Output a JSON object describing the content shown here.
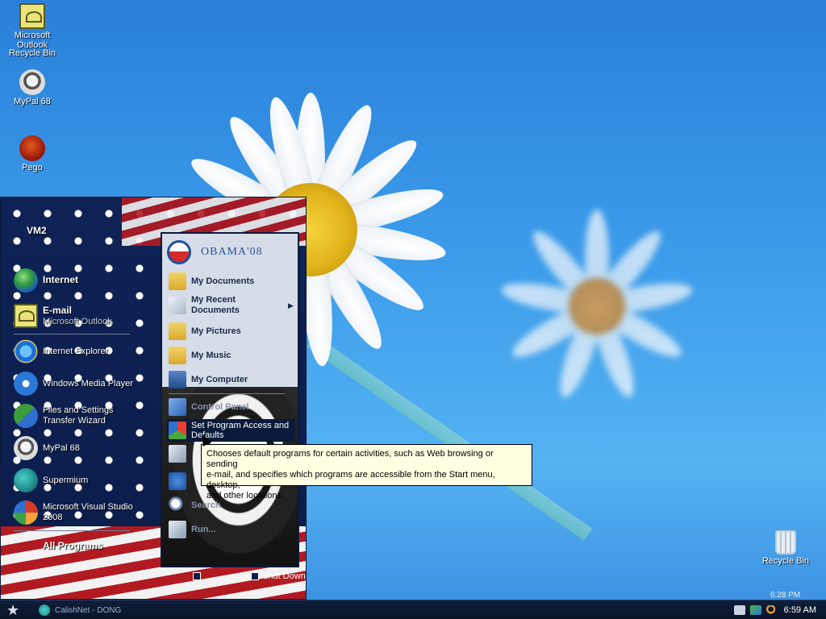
{
  "desktop_icons": [
    {
      "label": "Microsoft Outlook",
      "icon": "outlook-icon"
    },
    {
      "label": "Recycle Bin",
      "icon": "recycle-bin-icon"
    },
    {
      "label": "MyPal 68",
      "icon": "raccoon-icon"
    },
    {
      "label": "Pego",
      "icon": "pego-icon"
    },
    {
      "label": "Recycle Bin",
      "icon": "recycle-bin-icon"
    }
  ],
  "start_menu": {
    "user": "VM2",
    "pinned": [
      {
        "title": "Internet",
        "icon": "globe-icon"
      },
      {
        "title": "E-mail",
        "subtitle": "Microsoft Outlook",
        "icon": "outlook-icon"
      }
    ],
    "recent": [
      {
        "label": "Internet Explorer",
        "icon": "ie-icon"
      },
      {
        "label": "Windows Media Player",
        "icon": "wmp-icon"
      },
      {
        "label_line1": "Files and Settings",
        "label_line2": "Transfer Wizard",
        "icon": "files-settings-icon"
      },
      {
        "label": "MyPal 68",
        "icon": "raccoon-icon"
      },
      {
        "label": "Supermium",
        "icon": "supermium-icon"
      },
      {
        "label_line1": "Microsoft Visual Studio",
        "label_line2": "2008",
        "icon": "visual-studio-icon"
      }
    ],
    "all_programs": "All Programs",
    "right": {
      "logo_text": "OBAMA'08",
      "items": [
        {
          "label": "My Documents",
          "icon": "folder-icon"
        },
        {
          "label_line1": "My Recent",
          "label_line2": "Documents",
          "icon": "recent-docs-icon"
        },
        {
          "label": "My Pictures",
          "icon": "folder-icon"
        },
        {
          "label": "My Music",
          "icon": "folder-icon"
        },
        {
          "label": "My Computer",
          "icon": "computer-icon"
        }
      ],
      "control_panel": "Control Panel",
      "set_program_access_line1": "Set Program Access and",
      "set_program_access_line2": "Defaults",
      "search": "Search",
      "run": "Run..."
    },
    "shutdown": "Shut Down"
  },
  "tooltip": {
    "line1": "Chooses default programs for certain activities, such as Web browsing or sending",
    "line2": "e-mail, and specifies which programs are accessible from the Start menu, desktop,",
    "line3": "and other locations."
  },
  "taskbar": {
    "task_label": "CalishNet - DONG",
    "ghost_clock": "6:28 PM",
    "clock": "6:59 AM"
  }
}
